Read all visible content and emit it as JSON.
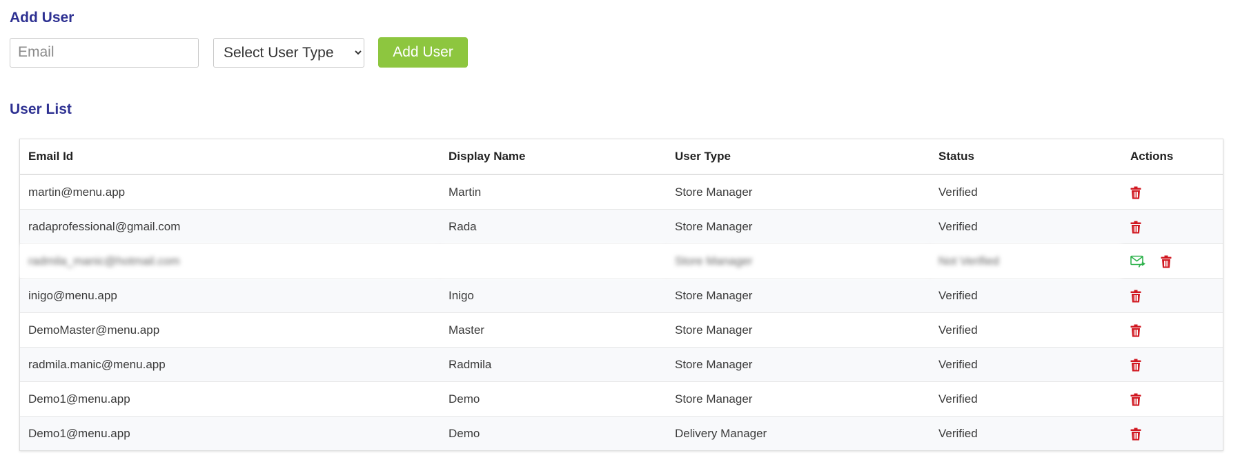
{
  "add_user": {
    "title": "Add User",
    "email_placeholder": "Email",
    "select_value": "Select User Type",
    "button_label": "Add User"
  },
  "user_list": {
    "title": "User List",
    "columns": [
      "Email Id",
      "Display Name",
      "User Type",
      "Status",
      "Actions"
    ],
    "rows": [
      {
        "email": "martin@menu.app",
        "name": "Martin",
        "type": "Store Manager",
        "status": "Verified",
        "actions": [
          "trash-icon"
        ]
      },
      {
        "email": "radaprofessional@gmail.com",
        "name": "Rada",
        "type": "Store Manager",
        "status": "Verified",
        "actions": [
          "trash-icon"
        ]
      },
      {
        "email": "radmila_manic@hotmail.com",
        "name": "",
        "type": "Store Manager",
        "status": "Not Verified",
        "actions": [
          "resend-mail-icon",
          "trash-icon"
        ],
        "blurred": true
      },
      {
        "email": "inigo@menu.app",
        "name": "Inigo",
        "type": "Store Manager",
        "status": "Verified",
        "actions": [
          "trash-icon"
        ]
      },
      {
        "email": "DemoMaster@menu.app",
        "name": "Master",
        "type": "Store Manager",
        "status": "Verified",
        "actions": [
          "trash-icon"
        ]
      },
      {
        "email": "radmila.manic@menu.app",
        "name": "Radmila",
        "type": "Store Manager",
        "status": "Verified",
        "actions": [
          "trash-icon"
        ]
      },
      {
        "email": "Demo1@menu.app",
        "name": "Demo",
        "type": "Store Manager",
        "status": "Verified",
        "actions": [
          "trash-icon"
        ]
      },
      {
        "email": "Demo1@menu.app",
        "name": "Demo",
        "type": "Delivery Manager",
        "status": "Verified",
        "actions": [
          "trash-icon"
        ]
      }
    ]
  },
  "colors": {
    "title": "#2e3192",
    "button": "#8dc63f",
    "trash": "#d0161f",
    "resend": "#2fb24c"
  }
}
